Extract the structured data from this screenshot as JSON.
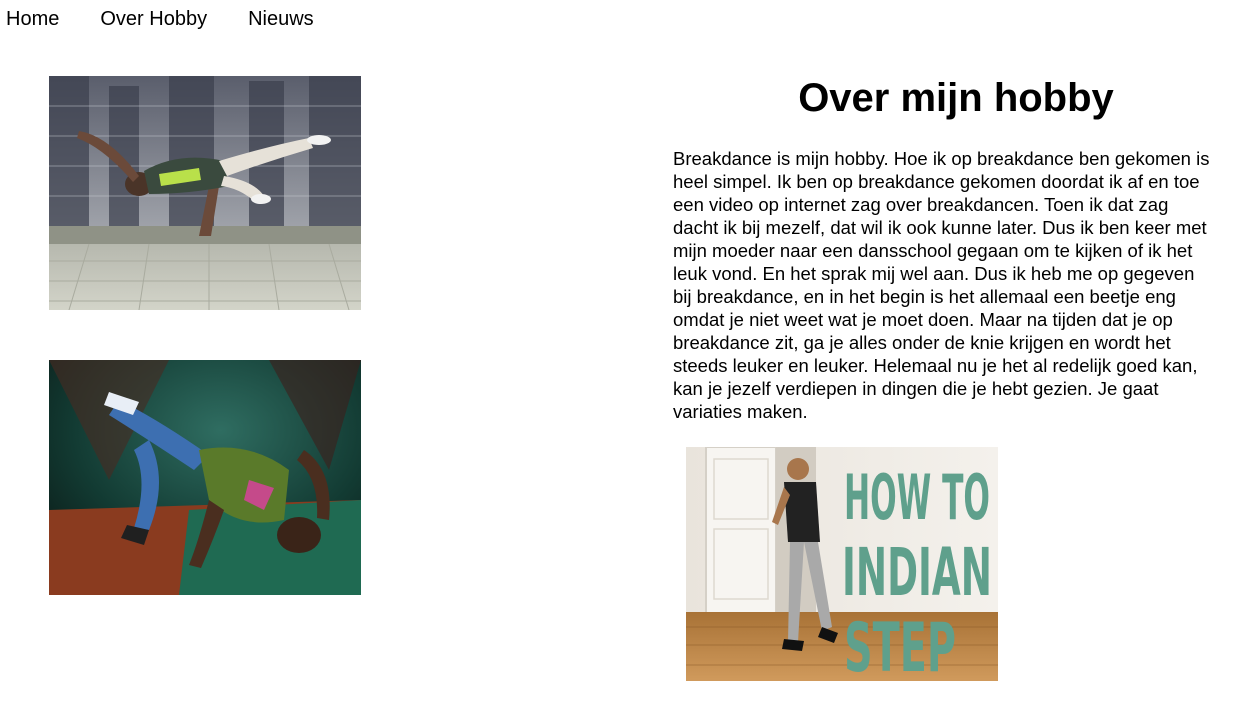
{
  "nav": {
    "items": [
      "Home",
      "Over Hobby",
      "Nieuws"
    ]
  },
  "main": {
    "title": "Over mijn hobby",
    "paragraph": "Breakdance is mijn hobby. Hoe ik op breakdance ben gekomen is heel simpel. Ik ben op breakdance gekomen doordat ik af en toe een video op internet zag over breakdancen. Toen ik dat zag dacht ik bij mezelf, dat wil ik ook kunne later. Dus ik ben keer met mijn moeder naar een dansschool gegaan om te kijken of ik het leuk vond. En het sprak mij wel aan. Dus ik heb me op gegeven bij breakdance, en in het begin is het allemaal een beetje eng omdat je niet weet wat je moet doen. Maar na tijden dat je op breakdance zit, ga je alles onder de knie krijgen en wordt het steeds leuker en leuker. Helemaal nu je het al redelijk goed kan, kan je jezelf verdiepen in dingen die je hebt gezien. Je gaat variaties maken."
  },
  "images": {
    "video_thumbnail_text": [
      "HOW TO",
      "INDIAN",
      "STEP"
    ]
  },
  "colors": {
    "thumbnail_text": "#5fa08c",
    "floor_wood": "#b98648",
    "stage_green": "#1f6a52"
  }
}
